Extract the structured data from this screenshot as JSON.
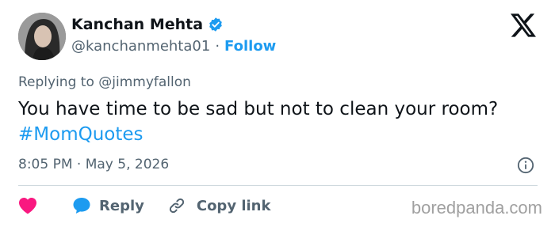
{
  "author": {
    "display_name": "Kanchan Mehta",
    "handle": "@kanchanmehta01",
    "separator": "·",
    "follow_label": "Follow",
    "verified_icon": "verified-badge-icon"
  },
  "platform_icon": "x-logo-icon",
  "reply_context": {
    "prefix": "Replying to",
    "mention": "@jimmyfallon"
  },
  "tweet": {
    "text": "You have time to be sad but not to clean your room?",
    "hashtag": "#MomQuotes"
  },
  "timestamp": "8:05 PM · May 5, 2026",
  "actions": {
    "like_icon": "heart-icon",
    "reply_label": "Reply",
    "copy_link_label": "Copy link"
  },
  "watermark": "boredpanda.com",
  "colors": {
    "accent": "#1d9bf0",
    "like": "#f91880",
    "secondary_text": "#536471",
    "primary_text": "#0f1419"
  }
}
